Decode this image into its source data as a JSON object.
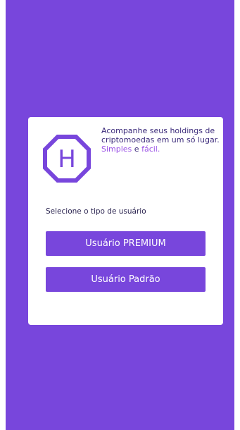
{
  "logo": {
    "icon": "hexagon-h-logo",
    "letter": "H"
  },
  "tagline": {
    "main": "Acompanhe seus holdings de criptomoedas em um só lugar.",
    "accent1": "Simples",
    "connector": "e",
    "accent2": "fácil."
  },
  "prompt": "Selecione o tipo de usuário",
  "buttons": {
    "premium": "Usuário PREMIUM",
    "padrao": "Usuário Padrão"
  },
  "colors": {
    "background": "#7846dc",
    "accent": "#9b52e6",
    "card": "#ffffff"
  }
}
